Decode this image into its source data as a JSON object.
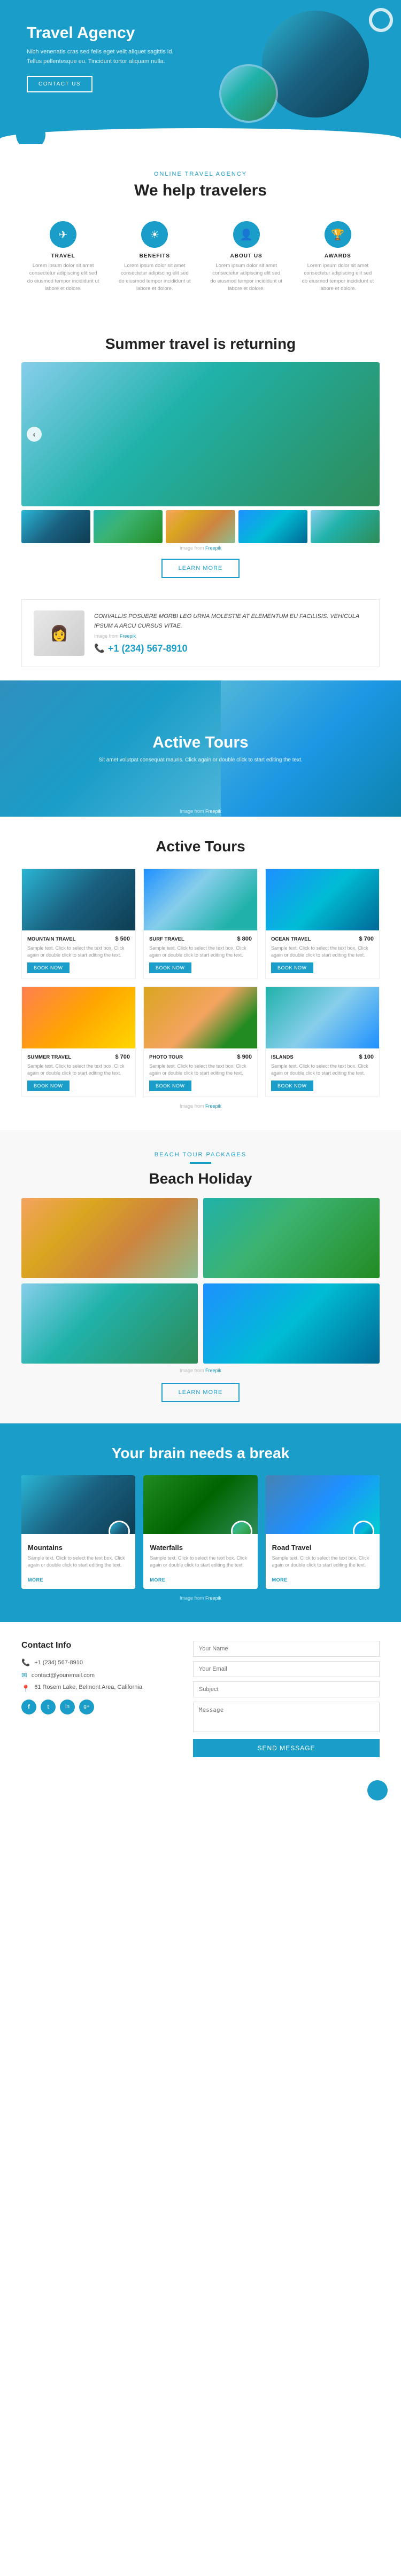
{
  "hero": {
    "title": "Travel Agency",
    "description": "Nibh venenatis cras sed felis eget velit aliquet sagittis id. Tellus pellentesque eu. Tincidunt tortor aliquam nulla.",
    "cta_label": "CONTACT US",
    "ring_decoration": true
  },
  "help_section": {
    "subtitle": "ONLINE TRAVEL AGENCY",
    "title": "We help travelers",
    "features": [
      {
        "id": "travel",
        "icon": "✈",
        "title": "TRAVEL",
        "text": "Lorem ipsum dolor sit amet consectetur adipiscing elit sed do eiusmod tempor incididunt ut labore et dolore."
      },
      {
        "id": "benefits",
        "icon": "★",
        "title": "BENEFITS",
        "text": "Lorem ipsum dolor sit amet consectetur adipiscing elit sed do eiusmod tempor incididunt ut labore et dolore."
      },
      {
        "id": "about",
        "icon": "ℹ",
        "title": "ABOUT US",
        "text": "Lorem ipsum dolor sit amet consectetur adipiscing elit sed do eiusmod tempor incididunt ut labore et dolore."
      },
      {
        "id": "awards",
        "icon": "🏆",
        "title": "AWARDS",
        "text": "Lorem ipsum dolor sit amet consectetur adipiscing elit sed do eiusmod tempor incididunt ut labore et dolore."
      }
    ]
  },
  "summer_section": {
    "title": "Summer travel is returning",
    "image_credit": "Image from Freepik",
    "thumbs": [
      "beach1",
      "beach2",
      "beach3",
      "beach4",
      "beach5"
    ],
    "learn_more_label": "LEARN MORE"
  },
  "contact_banner": {
    "quote": "CONVALLIS POSUERE MORBI LEO URNA MOLESTIE AT ELEMENTUM EU FACILISIS. VEHICULA IPSUM A ARCU CURSUS VITAE.",
    "credit": "Image from Freepik",
    "phone": "+1 (234) 567-8910"
  },
  "active_banner": {
    "title": "Active Tours",
    "description": "Sit amet volutpat consequat mauris. Click again or double click to start editing the text.",
    "credit": "Image from Freepik"
  },
  "tours_section": {
    "title": "Active Tours",
    "tours": [
      {
        "name": "MOUNTAIN TRAVEL",
        "price": "$ 500",
        "price_unit": "",
        "description": "Sample text. Click to select the text box. Click again or double click to start editing the text.",
        "img_class": "img-mountain",
        "book_label": "BOOK NOW"
      },
      {
        "name": "SURF TRAVEL",
        "price": "$ 800",
        "price_unit": "",
        "description": "Sample text. Click to select the text box. Click again or double click to start editing the text.",
        "img_class": "img-surf",
        "book_label": "BOOK NOW"
      },
      {
        "name": "OCEAN TRAVEL",
        "price": "$ 700",
        "price_unit": "",
        "description": "Sample text. Click to select the text box. Click again or double click to start editing the text.",
        "img_class": "img-ocean",
        "book_label": "BOOK NOW"
      },
      {
        "name": "SUMMER TRAVEL",
        "price": "$ 700",
        "price_unit": "",
        "description": "Sample text. Click to select the text box. Click again or double click to start editing the text.",
        "img_class": "img-summer",
        "book_label": "BOOK NOW"
      },
      {
        "name": "PHOTO TOUR",
        "price": "$ 900",
        "price_unit": "",
        "description": "Sample text. Click to select the text box. Click again or double click to start editing the text.",
        "img_class": "img-photo",
        "book_label": "BOOK NOW"
      },
      {
        "name": "ISLANDS",
        "price": "$ 100",
        "price_unit": "",
        "description": "Sample text. Click to select the text box. Click again or double click to start editing the text.",
        "img_class": "img-island",
        "book_label": "BOOK NOW"
      }
    ],
    "credit": "Image from Freepik"
  },
  "beach_section": {
    "subtitle": "BEACH TOUR PACKAGES",
    "title": "Beach Holiday",
    "learn_more_label": "LEARN MORE",
    "credit": "Image from Freepik"
  },
  "brain_section": {
    "title": "Your brain needs a break",
    "cards": [
      {
        "name": "Mountains",
        "description": "Sample text. Click to select the text box. Click again or double click to start editing the text.",
        "more_label": "MORE",
        "img_class": "img-mountain"
      },
      {
        "name": "Waterfalls",
        "description": "Sample text. Click to select the text box. Click again or double click to start editing the text.",
        "more_label": "MORE",
        "img_class": "img-forest"
      },
      {
        "name": "Road Travel",
        "description": "Sample text. Click to select the text box. Click again or double click to start editing the text.",
        "more_label": "MORE",
        "img_class": "img-city"
      }
    ],
    "credit": "Image from Freepik",
    "editing_hint": "double click to start editing"
  },
  "contact_section": {
    "title": "Contact Info",
    "phone": "+1 (234) 567-8910",
    "email": "contact@youremail.com",
    "address": "61 Rosem Lake, Belmont Area, California",
    "social": [
      "f",
      "t",
      "in",
      "g+"
    ],
    "form": {
      "name_placeholder": "Your Name",
      "email_placeholder": "Your Email",
      "subject_placeholder": "Subject",
      "message_placeholder": "Message",
      "send_label": "SEND MESSAGE"
    }
  },
  "colors": {
    "primary": "#1a9dc8",
    "dark": "#222222",
    "light_gray": "#f8f8f8",
    "text_gray": "#888888"
  }
}
